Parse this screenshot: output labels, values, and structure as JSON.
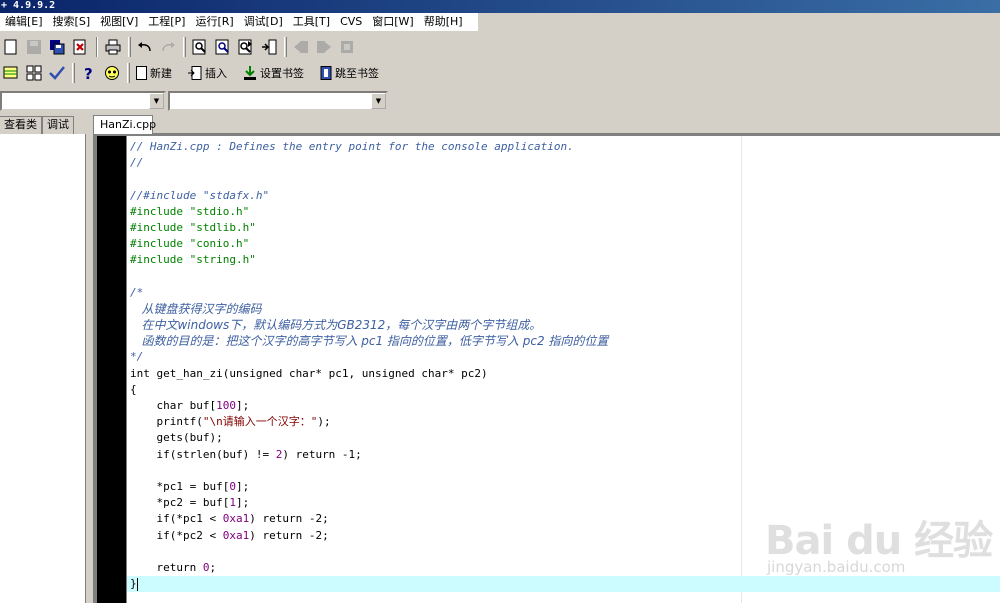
{
  "window": {
    "title": "+ 4.9.9.2"
  },
  "menu": [
    "编辑[E]",
    "搜索[S]",
    "视图[V]",
    "工程[P]",
    "运行[R]",
    "调试[D]",
    "工具[T]",
    "CVS",
    "窗口[W]",
    "帮助[H]"
  ],
  "toolbar2": {
    "new_label": "新建",
    "insert_label": "插入",
    "set_bookmark_label": "设置书签",
    "goto_bookmark_label": "跳至书签"
  },
  "left_tabs": [
    "查看类",
    "调试"
  ],
  "file_tab": "HanZi.cpp",
  "code": {
    "l1": "// HanZi.cpp : Defines the entry point for the console application.",
    "l2": "//",
    "l3": "",
    "l4": "//#include \"stdafx.h\"",
    "l5": "#include \"stdio.h\"",
    "l6": "#include \"stdlib.h\"",
    "l7": "#include \"conio.h\"",
    "l8": "#include \"string.h\"",
    "l10": "/*",
    "l11": "   从键盘获得汉字的编码",
    "l12": "   在中文windows下，默认编码方式为GB2312，每个汉字由两个字节组成。",
    "l13": "   函数的目的是：把这个汉字的高字节写入 pc1 指向的位置，低字节写入 pc2 指向的位置",
    "l14": "*/",
    "l15": "int get_han_zi(unsigned char* pc1, unsigned char* pc2)",
    "l16": "{",
    "l17a": "    char buf[",
    "l17n": "100",
    "l17b": "];",
    "l18a": "    printf(",
    "l18s": "\"\\n请输入一个汉字：\"",
    "l18b": ");",
    "l19": "    gets(buf);",
    "l20a": "    if(strlen(buf) != ",
    "l20n": "2",
    "l20b": ") return -1;",
    "l22a": "    *pc1 = buf[",
    "l22n": "0",
    "l22b": "];",
    "l23a": "    *pc2 = buf[",
    "l23n": "1",
    "l23b": "];",
    "l24a": "    if(*pc1 < ",
    "l24n": "0xa1",
    "l24b": ") return -2;",
    "l25a": "    if(*pc2 < ",
    "l25n": "0xa1",
    "l25b": ") return -2;",
    "l27a": "    return ",
    "l27n": "0",
    "l27b": ";",
    "l28": "}"
  },
  "watermark": {
    "brand": "Bai du 经验",
    "url": "jingyan.baidu.com"
  },
  "colors": {
    "comment": "#3d5fa0",
    "preprocessor": "#008000",
    "string": "#800000",
    "number": "#800080",
    "current_line": "#ccfcff"
  }
}
